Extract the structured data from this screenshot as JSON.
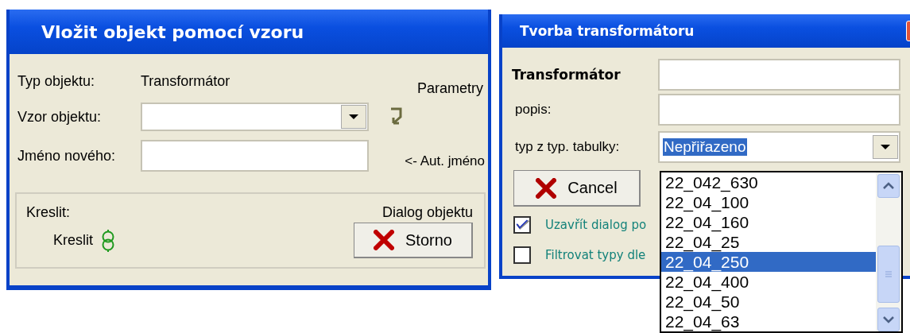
{
  "insert_dialog": {
    "title": "Vložit objekt pomocí vzoru",
    "object_type_label": "Typ objektu:",
    "object_type_value": "Transformátor",
    "parameters_label": "Parametry",
    "pattern_label": "Vzor objektu:",
    "name_label": "Jméno nového:",
    "auto_name_label": "<- Aut. jméno",
    "draw_group": {
      "label": "Kreslit:",
      "draw_label": "Kreslit",
      "dialog_label": "Dialog objektu",
      "cancel_button": "Storno"
    }
  },
  "transformer_dialog": {
    "title": "Tvorba transformátoru",
    "name_label": "Transformátor",
    "description_label": "popis:",
    "type_label": "typ z typ. tabulky:",
    "type_value": "Nepřiřazeno",
    "cancel_button": "Cancel",
    "options": [
      {
        "label": "Uzavřít dialog po",
        "checked": true
      },
      {
        "label": "Filtrovat typy dle",
        "checked": false
      }
    ],
    "dropdown_items": [
      {
        "label": "22_042_630",
        "selected": false
      },
      {
        "label": "22_04_100",
        "selected": false
      },
      {
        "label": "22_04_160",
        "selected": false
      },
      {
        "label": "22_04_25",
        "selected": false
      },
      {
        "label": "22_04_250",
        "selected": true
      },
      {
        "label": "22_04_400",
        "selected": false
      },
      {
        "label": "22_04_50",
        "selected": false
      },
      {
        "label": "22_04_63",
        "selected": false
      }
    ]
  }
}
